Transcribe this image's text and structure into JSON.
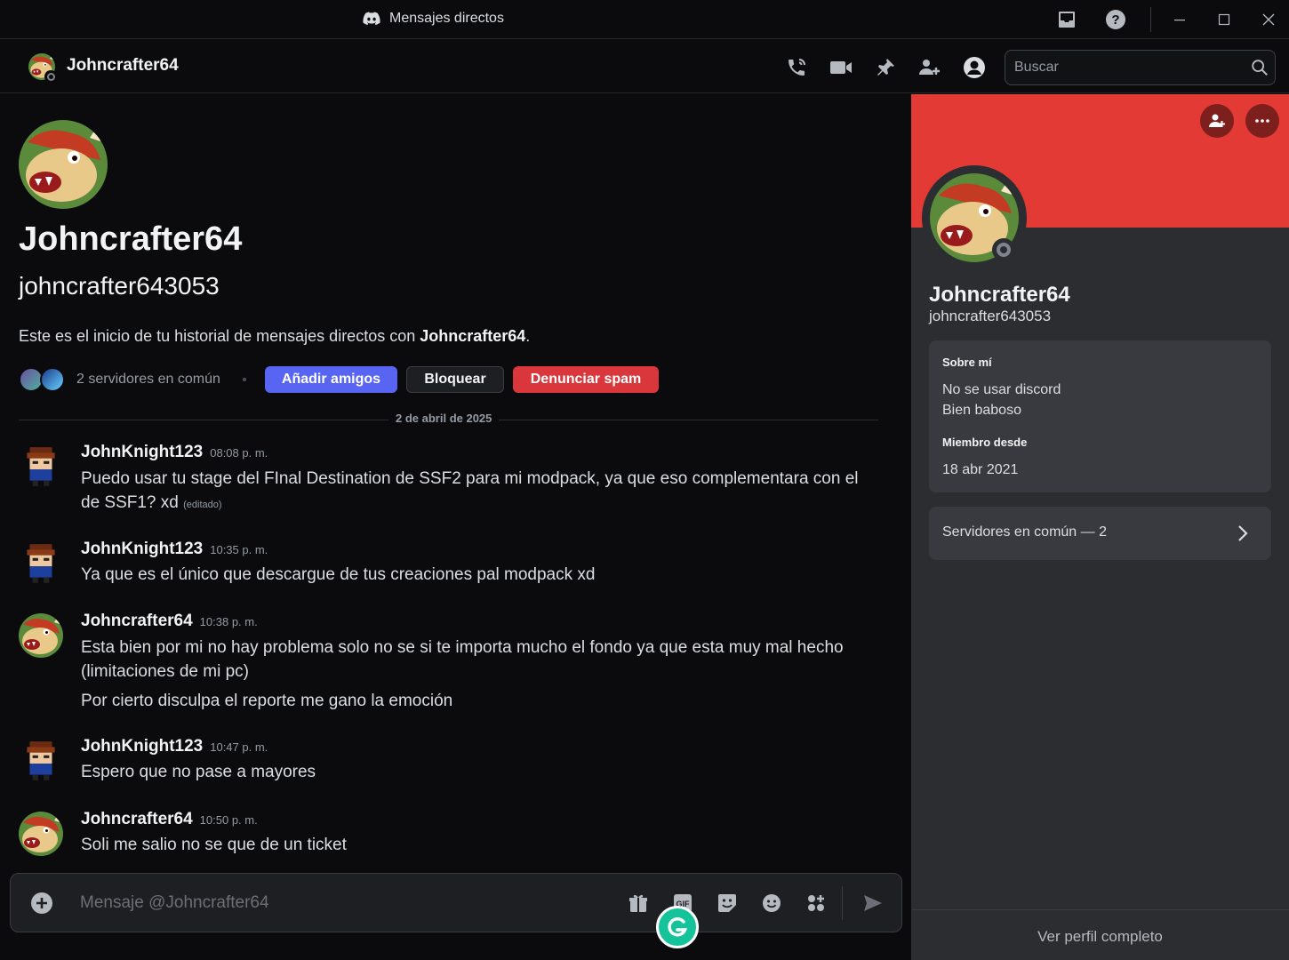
{
  "window": {
    "title": "Mensajes directos"
  },
  "header": {
    "name": "Johncrafter64",
    "search_placeholder": "Buscar"
  },
  "intro": {
    "display_name": "Johncrafter64",
    "username": "johncrafter643053",
    "text_prefix": "Este es el inicio de tu historial de mensajes directos con ",
    "text_name": "Johncrafter64",
    "text_suffix": ".",
    "common_servers": "2 servidores en común",
    "add_friend": "Añadir amigos",
    "block": "Bloquear",
    "report_spam": "Denunciar spam"
  },
  "date_divider": "2 de abril de 2025",
  "messages": [
    {
      "author": "JohnKnight123",
      "time": "08:08 p. m.",
      "lines": [
        "Puedo usar tu stage del FInal Destination de SSF2 para mi modpack, ya que eso complementara con el",
        "de SSF1? xd"
      ],
      "edited": "(editado)"
    },
    {
      "author": "JohnKnight123",
      "time": "10:35 p. m.",
      "lines": [
        "Ya que es el único que descargue de tus creaciones pal modpack xd"
      ]
    },
    {
      "author": "Johncrafter64",
      "time": "10:38 p. m.",
      "lines": [
        "Esta bien por mi no hay problema  solo no se si te importa mucho el fondo ya que esta muy mal hecho",
        "(limitaciones de mi pc)",
        "Por cierto disculpa el reporte me gano la emoción"
      ]
    },
    {
      "author": "JohnKnight123",
      "time": "10:47 p. m.",
      "lines": [
        "Espero que no pase a mayores"
      ]
    },
    {
      "author": "Johncrafter64",
      "time": "10:50 p. m.",
      "lines": [
        "Soli me salio no se que de un ticket"
      ]
    }
  ],
  "composer": {
    "placeholder": "Mensaje @Johncrafter64"
  },
  "profile": {
    "display_name": "Johncrafter64",
    "username": "johncrafter643053",
    "about_heading": "Sobre mí",
    "about_lines": [
      "No se usar discord",
      "Bien baboso"
    ],
    "member_since_heading": "Miembro desde",
    "member_since": "18 abr 2021",
    "common_servers": "Servidores en común — 2",
    "view_full": "Ver perfil completo",
    "banner_color": "#e33a36"
  },
  "colors": {
    "accent": "#5865f2",
    "danger": "#da373c",
    "background": "#0b0b0d"
  }
}
